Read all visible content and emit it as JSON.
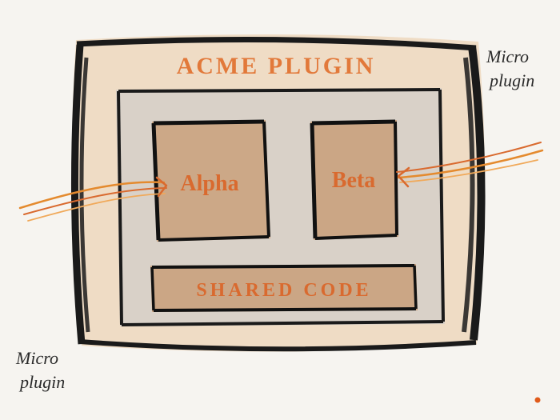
{
  "diagram": {
    "title": "ACME PLUGIN",
    "boxes": {
      "alpha": "Alpha",
      "beta": "Beta",
      "shared": "SHARED CODE"
    },
    "annotations": {
      "left": "Micro plugin",
      "right": "Micro plugin"
    }
  }
}
